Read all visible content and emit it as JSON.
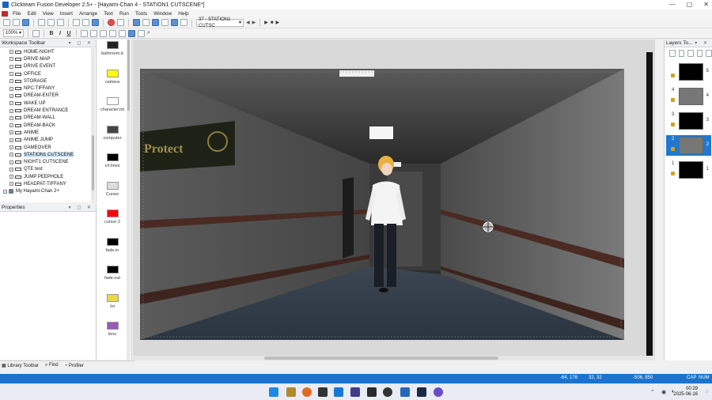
{
  "window": {
    "title": "Clickteam Fusion Developer 2.5+ - [Hayami-Chan 4 - STATION1 CUTSCENE*]",
    "controls": [
      "—",
      "▢",
      "✕"
    ]
  },
  "menu": [
    "File",
    "Edit",
    "View",
    "Insert",
    "Arrange",
    "Text",
    "Run",
    "Tools",
    "Window",
    "Help"
  ],
  "toolbar": {
    "frame_select": "37 - STATION1 CUTSC",
    "zoom": "100%",
    "text_buttons": [
      "B",
      "I",
      "U"
    ]
  },
  "workspace": {
    "title": "Workspace Toolbar",
    "items": [
      "HOME-NIGHT",
      "DRIVE-MAP",
      "DRIVE EVENT",
      "OFFICE",
      "STORAGE",
      "NPC-TIFFANY",
      "DREAM-ENTER",
      "WAKE UP",
      "DREAM ENTRANCE",
      "DREAM-WALL",
      "DREAM-BACK",
      "ANIME",
      "ANIME JUMP",
      "GAMEOVER",
      "STATION1 CUTSCENE",
      "NIGHT1 CUTSCENE",
      "QTE test",
      "JUMP PEEPHOLE",
      "HEADPAT-TIFFANY"
    ],
    "selected": "STATION1 CUTSCENE",
    "app_item": "My Hayami-Chan 2+"
  },
  "properties": {
    "title": "Properties"
  },
  "palette": {
    "items": [
      {
        "label": "bathroom.b",
        "color": "#222222"
      },
      {
        "label": "camera",
        "color": "#ffff00"
      },
      {
        "label": "character.txt",
        "color": "#ffffff"
      },
      {
        "label": "computer",
        "color": "#444444"
      },
      {
        "label": "crt.lines",
        "color": "#000000"
      },
      {
        "label": "Cursor",
        "color": "#dddddd"
      },
      {
        "label": "cursor 2",
        "color": "#ff0000"
      },
      {
        "label": "fade.in",
        "color": "#000000"
      },
      {
        "label": "fade.out",
        "color": "#000000"
      },
      {
        "label": "Ini",
        "color": "#e8d84a"
      },
      {
        "label": "lens",
        "color": "#9b59b6"
      }
    ]
  },
  "layers": {
    "title": "Layers To...",
    "items": [
      {
        "index_left": "",
        "index_right": "5"
      },
      {
        "index_left": "4",
        "index_right": "4"
      },
      {
        "index_left": "3",
        "index_right": "3"
      },
      {
        "index_left": "2",
        "index_right": "2"
      },
      {
        "index_left": "1",
        "index_right": "1"
      }
    ],
    "selected_index": 3
  },
  "bottom_tabs": [
    "Library Toolbar",
    "Find",
    "Profiler"
  ],
  "status": {
    "cursor_pos": "-64, 176",
    "size": "32, 32",
    "world_pos": "-506, 850",
    "caps": "CAP",
    "num": "NUM"
  },
  "clock": {
    "time": "00:29",
    "date": "2025-06-16"
  },
  "scene": {
    "sign_text": "Protect"
  }
}
